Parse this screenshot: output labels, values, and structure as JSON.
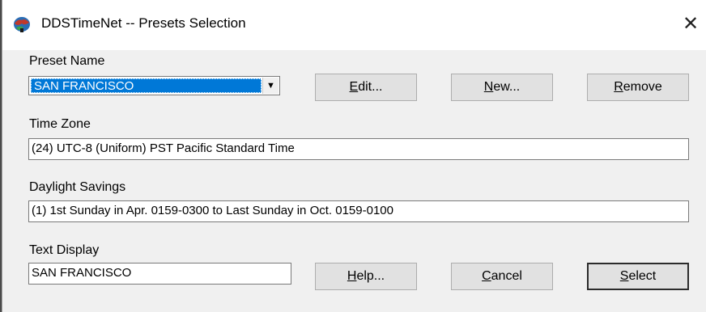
{
  "window": {
    "title": "DDSTimeNet -- Presets Selection",
    "close_glyph": "✕",
    "icon": "globe-icon"
  },
  "preset": {
    "label": "Preset Name",
    "selected": "SAN FRANCISCO"
  },
  "buttons": {
    "edit": {
      "accel": "E",
      "rest": "dit..."
    },
    "new": {
      "accel": "N",
      "rest": "ew..."
    },
    "remove": {
      "accel": "R",
      "rest": "emove"
    },
    "help": {
      "accel": "H",
      "rest": "elp..."
    },
    "cancel": {
      "accel": "C",
      "rest": "ancel"
    },
    "select": {
      "accel": "S",
      "rest": "elect"
    }
  },
  "time_zone": {
    "label": "Time Zone",
    "value": "(24) UTC-8 (Uniform) PST Pacific Standard Time"
  },
  "daylight": {
    "label": "Daylight Savings",
    "value": "(1) 1st Sunday in Apr. 0159-0300 to Last Sunday in Oct. 0159-0100"
  },
  "text_display": {
    "label": "Text Display",
    "value": "SAN FRANCISCO"
  },
  "colors": {
    "selection": "#0078d7",
    "dialog_bg": "#f0f0f0",
    "button_bg": "#e1e1e1"
  }
}
